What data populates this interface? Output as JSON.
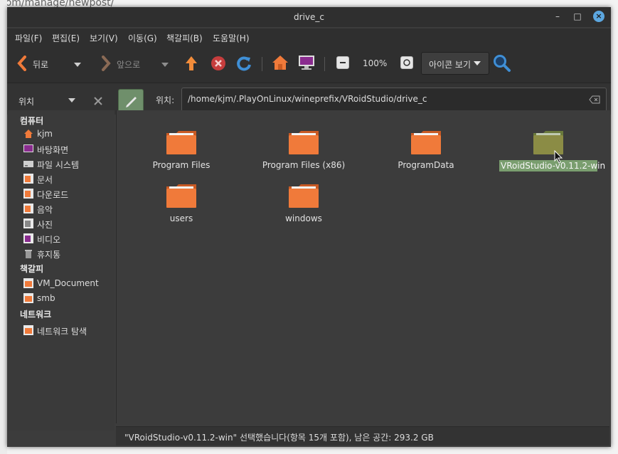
{
  "background": {
    "url_fragment": "com/manage/newpost/"
  },
  "window": {
    "title": "drive_c",
    "controls": [
      "–",
      "□",
      "×"
    ]
  },
  "menubar": {
    "items": [
      "파일(F)",
      "편집(E)",
      "보기(V)",
      "이동(G)",
      "책갈피(B)",
      "도움말(H)"
    ]
  },
  "toolbar": {
    "back_label": "뒤로",
    "forward_label": "앞으로",
    "zoom": "100%",
    "view_mode": "아이콘 보기"
  },
  "location": {
    "sidebar_mode": "위치",
    "label": "위치:",
    "path": "/home/kjm/.PlayOnLinux/wineprefix/VRoidStudio/drive_c"
  },
  "sidebar": {
    "computer_head": "컴퓨터",
    "computer_items": [
      {
        "label": "kjm",
        "icon": "home-icon"
      },
      {
        "label": "바탕화면",
        "icon": "desktop-icon"
      },
      {
        "label": "파일 시스템",
        "icon": "drive-icon"
      },
      {
        "label": "문서",
        "icon": "documents-icon"
      },
      {
        "label": "다운로드",
        "icon": "downloads-icon"
      },
      {
        "label": "음악",
        "icon": "music-icon"
      },
      {
        "label": "사진",
        "icon": "pictures-icon"
      },
      {
        "label": "비디오",
        "icon": "videos-icon"
      },
      {
        "label": "휴지통",
        "icon": "trash-icon"
      }
    ],
    "bookmarks_head": "책갈피",
    "bookmark_items": [
      {
        "label": "VM_Document",
        "icon": "folder-icon"
      },
      {
        "label": "smb",
        "icon": "folder-icon"
      }
    ],
    "network_head": "네트워크",
    "network_items": [
      {
        "label": "네트워크 탐색",
        "icon": "network-icon"
      }
    ]
  },
  "files": [
    {
      "name": "Program Files",
      "selected": false
    },
    {
      "name": "Program Files (x86)",
      "selected": false
    },
    {
      "name": "ProgramData",
      "selected": false
    },
    {
      "name": "VRoidStudio-v0.11.2-win",
      "selected": true
    },
    {
      "name": "users",
      "selected": false
    },
    {
      "name": "windows",
      "selected": false
    }
  ],
  "status": {
    "text": "\"VRoidStudio-v0.11.2-win\" 선택했습니다(항목 15개 포함), 남은 공간: 293.2 GB"
  },
  "colors": {
    "window_bg": "#3c3c3c",
    "folder_orange": "#f07a3a",
    "selection_green": "#7a9e6f",
    "accent_blue": "#5ca7e0"
  }
}
